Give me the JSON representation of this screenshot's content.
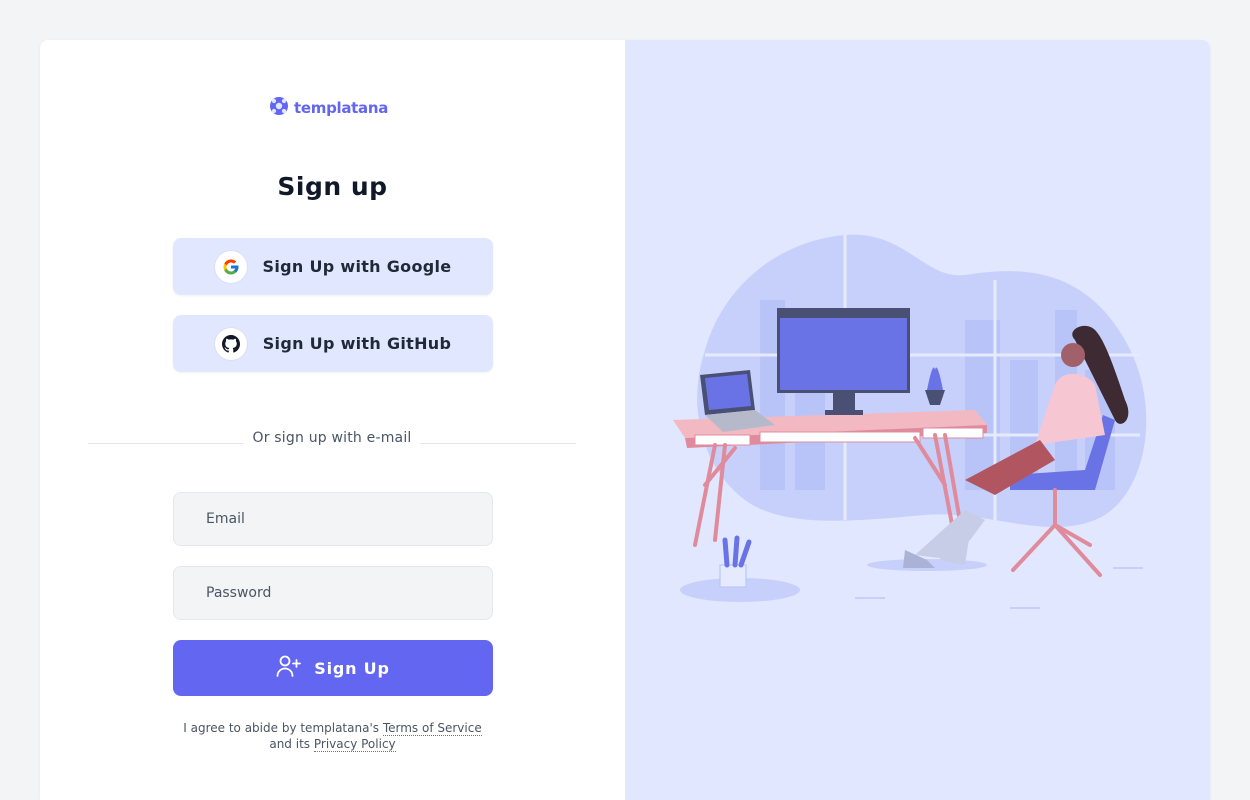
{
  "brand": {
    "name": "templatana",
    "color": "#6366f1"
  },
  "page_title": "Sign up",
  "social": [
    {
      "label": "Sign Up with Google",
      "icon": "google-icon"
    },
    {
      "label": "Sign Up with GitHub",
      "icon": "github-icon"
    }
  ],
  "divider_text": "Or sign up with e-mail",
  "form": {
    "email_placeholder": "Email",
    "password_placeholder": "Password",
    "submit_label": "Sign Up",
    "submit_icon": "user-plus-icon"
  },
  "terms": {
    "prefix": "I agree to abide by templatana's",
    "tos_link": "Terms of Service",
    "middle": "and its",
    "privacy_link": "Privacy Policy"
  },
  "colors": {
    "accent": "#6366f1",
    "social_bg": "#e0e7ff",
    "panel_bg": "#e0e7ff",
    "input_bg": "#f3f4f6"
  },
  "illustration": "woman-at-desk-illustration"
}
